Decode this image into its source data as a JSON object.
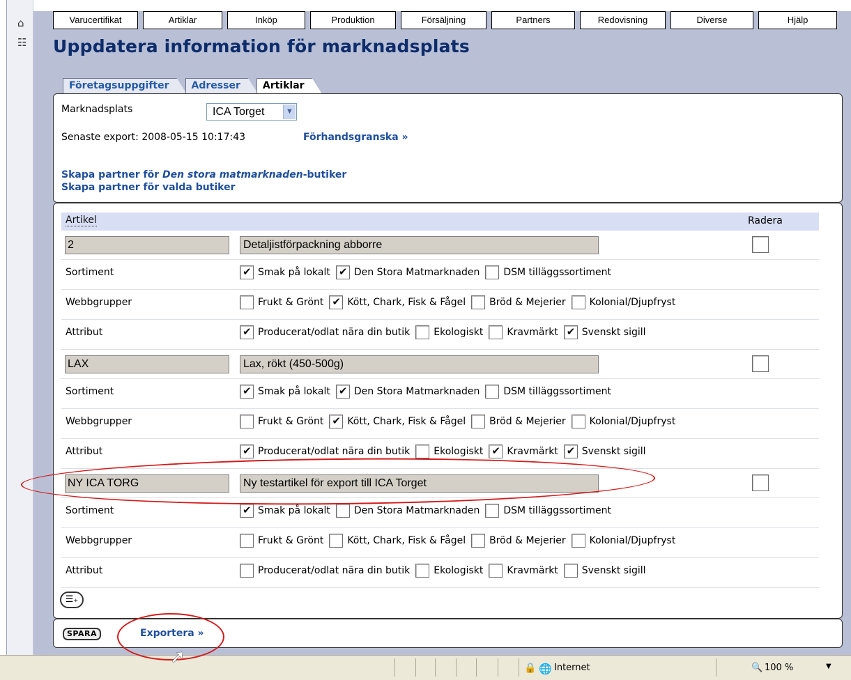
{
  "menu": [
    "Varucertifikat",
    "Artiklar",
    "Inköp",
    "Produktion",
    "Försäljning",
    "Partners",
    "Redovisning",
    "Diverse",
    "Hjälp"
  ],
  "page_title": "Uppdatera information för marknadsplats",
  "tabs": [
    "Företagsuppgifter",
    "Adresser",
    "Artiklar"
  ],
  "top": {
    "market_label": "Marknadsplats",
    "market_value": "ICA Torget",
    "export_text": "Senaste export: 2008-05-15 10:17:43",
    "preview_link": "Förhandsgranska »",
    "create_partner_prefix": "Skapa partner för ",
    "create_partner_italic": "Den stora matmarknaden",
    "create_partner_suffix": "-butiker",
    "create_partner_selected": "Skapa partner för valda butiker"
  },
  "table": {
    "col_artikel": "Artikel",
    "col_radera": "Radera",
    "label_sortiment": "Sortiment",
    "label_webbgrupper": "Webbgrupper",
    "label_attribut": "Attribut",
    "sortiment_opts": [
      "Smak på lokalt",
      "Den Stora Matmarknaden",
      "DSM tilläggssortiment"
    ],
    "webb_opts": [
      "Frukt & Grönt",
      "Kött, Chark, Fisk & Fågel",
      "Bröd & Mejerier",
      "Kolonial/Djupfryst"
    ],
    "attr_opts": [
      "Producerat/odlat nära din butik",
      "Ekologiskt",
      "Kravmärkt",
      "Svenskt sigill"
    ],
    "articles": [
      {
        "code": "2",
        "desc": "Detaljistförpackning abborre",
        "sortiment": [
          true,
          true,
          false
        ],
        "webb": [
          false,
          true,
          false,
          false
        ],
        "attr": [
          true,
          false,
          false,
          true
        ]
      },
      {
        "code": "LAX",
        "desc": "Lax, rökt (450-500g)",
        "sortiment": [
          true,
          true,
          false
        ],
        "webb": [
          false,
          true,
          false,
          false
        ],
        "attr": [
          true,
          false,
          true,
          true
        ]
      },
      {
        "code": "NY ICA TORG",
        "desc": "Ny testartikel för export till ICA Torget",
        "sortiment": [
          true,
          false,
          false
        ],
        "webb": [
          false,
          false,
          false,
          false
        ],
        "attr": [
          false,
          false,
          false,
          false
        ]
      }
    ]
  },
  "footer": {
    "save_label": "SPARA",
    "export_link": "Exportera »"
  },
  "status": {
    "zone": "Internet",
    "zoom": "100 %"
  },
  "colors": {
    "title": "#0d2c6b",
    "link": "#1f4f9c",
    "annotation": "#d41a1a"
  }
}
